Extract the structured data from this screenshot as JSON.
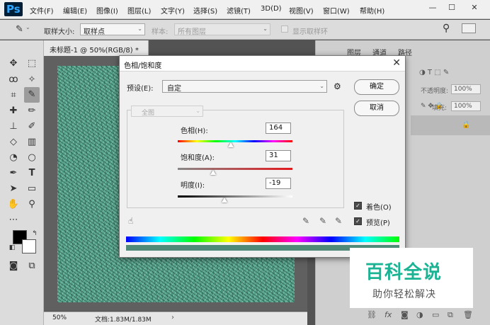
{
  "app": {
    "logo": "Ps"
  },
  "menu": [
    "文件(F)",
    "编辑(E)",
    "图像(I)",
    "图层(L)",
    "文字(Y)",
    "选择(S)",
    "滤镜(T)",
    "3D(D)",
    "视图(V)",
    "窗口(W)",
    "帮助(H)"
  ],
  "window_controls": {
    "minimize": "—",
    "maximize": "☐",
    "close": "✕"
  },
  "options_bar": {
    "sample_size_label": "取样大小:",
    "sample_size_value": "取样点",
    "sample_label": "样本:",
    "sample_value": "所有图层",
    "show_ring_label": "显示取样环"
  },
  "document": {
    "tab_title": "未标题-1 @ 50%(RGB/8) *",
    "zoom": "50%",
    "doc_info": "文档:1.83M/1.83M"
  },
  "right_panel": {
    "tabs": [
      "图层",
      "通道",
      "路径"
    ],
    "opacity_label": "不透明度:",
    "opacity_value": "100%",
    "fill_label": "填充:",
    "fill_value": "100%"
  },
  "dialog": {
    "title": "色相/饱和度",
    "close": "✕",
    "preset_label": "预设(E):",
    "preset_value": "自定",
    "ok_label": "确定",
    "cancel_label": "取消",
    "edit_channel": "全图",
    "hue_label": "色相(H):",
    "hue_value": "164",
    "saturation_label": "饱和度(A):",
    "saturation_value": "31",
    "lightness_label": "明度(I):",
    "lightness_value": "-19",
    "colorize_label": "着色(O)",
    "colorize_checked": true,
    "preview_label": "预览(P)",
    "preview_checked": true,
    "hue_level": 0.46,
    "saturation_level": 0.31,
    "lightness_level": 0.41
  },
  "watermark": {
    "main": "百科全说",
    "sub": "助你轻松解决",
    "color": "#1ab394"
  },
  "colors": {
    "canvas_fill": "#5aa58e",
    "accent": "#31a8ff"
  }
}
